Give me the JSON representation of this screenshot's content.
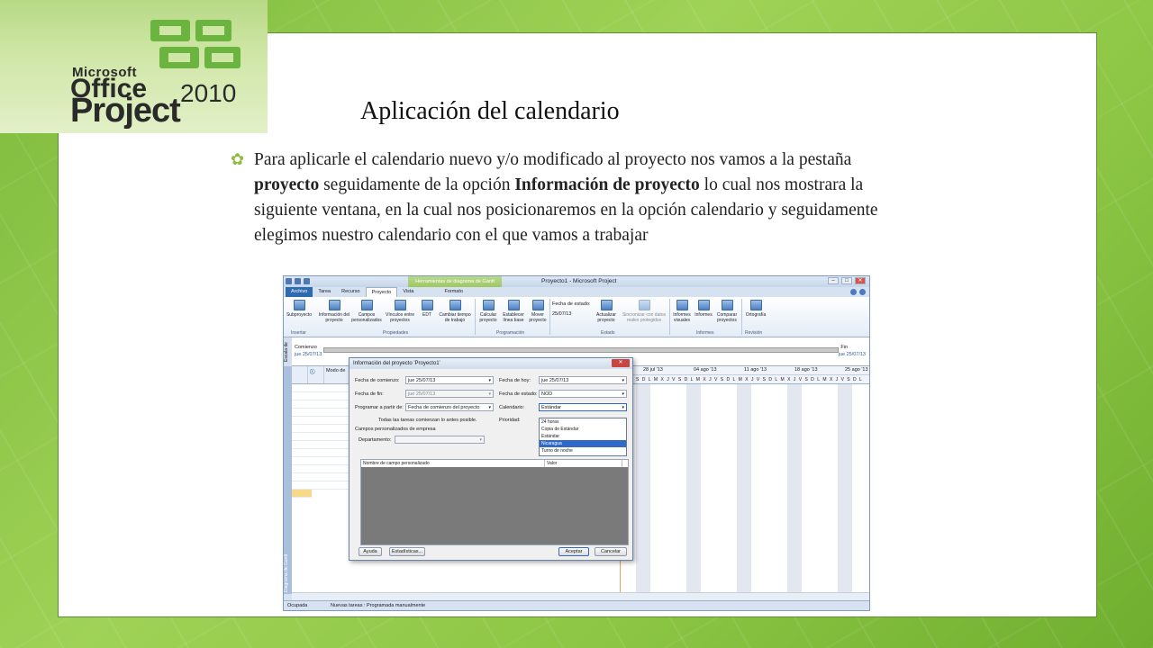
{
  "logo": {
    "microsoft": "Microsoft",
    "office": "Office",
    "year": "2010",
    "project": "Project",
    "mark_color": "#6ab43f"
  },
  "slide": {
    "title": "Aplicación del calendario",
    "bullet_parts": [
      "Para aplicarle el calendario nuevo y/o modificado al proyecto nos vamos a la pestaña ",
      "proyecto",
      " seguidamente de la opción ",
      "Información de proyecto",
      " lo cual nos mostrara la siguiente ventana, en la cual nos posicionaremos en la opción calendario y seguidamente elegimos nuestro calendario con el que vamos a trabajar"
    ]
  },
  "app": {
    "context_tab": "Herramientas de diagrama de Gantt",
    "window_title": "Proyecto1 - Microsoft Project",
    "tabs": [
      "Archivo",
      "Tarea",
      "Recurso",
      "Proyecto",
      "Vista",
      "Formato"
    ],
    "ribbon": {
      "buttons": [
        {
          "label": "Subproyecto"
        },
        {
          "label": "Información del proyecto"
        },
        {
          "label": "Campos personalizados"
        },
        {
          "label": "Vínculos entre proyectos"
        },
        {
          "label": "EDT"
        },
        {
          "label": "Cambiar tiempo de trabajo"
        },
        {
          "label": "Calcular proyecto"
        },
        {
          "label": "Establecer línea base"
        },
        {
          "label": "Mover proyecto"
        },
        {
          "label": "Actualizar proyecto"
        },
        {
          "label": "Sincronizar con datos reales protegidos"
        },
        {
          "label": "Informes visuales"
        },
        {
          "label": "Informes"
        },
        {
          "label": "Comparar proyectos"
        },
        {
          "label": "Ortografía"
        }
      ],
      "groups": [
        "Insertar",
        "Propiedades",
        "Programación",
        "Estado",
        "Informes",
        "Revisión"
      ],
      "fecha_estado_label": "Fecha de estado:",
      "fecha_estado_value": "25/07/13"
    },
    "timeline": {
      "side_label": "Escala de",
      "start_label": "Comienzo",
      "start_date": "jue 25/07/13",
      "end_label": "Fin",
      "end_date": "jue 25/07/13"
    },
    "grid": {
      "headers": [
        "",
        "ⓘ",
        "Modo de",
        "",
        "",
        ""
      ]
    },
    "side_view_label": "Diagrama de Gantt",
    "chart": {
      "weeks": [
        "28 jul '13",
        "04 ago '13",
        "11 ago '13",
        "18 ago '13",
        "25 ago '13"
      ],
      "days": "SDLMXJVSDLMXJVSDLMXJVSDLMXJVSDLMXJVSDL"
    },
    "status": {
      "mode": "Ocupada",
      "new_tasks": "Nuevas tareas : Programada manualmente"
    }
  },
  "dialog": {
    "title": "Información del proyecto 'Proyecto1'",
    "close": "✕",
    "fecha_comienzo_label": "Fecha de comienzo:",
    "fecha_comienzo_value": "jue 25/07/13",
    "fecha_hoy_label": "Fecha de hoy:",
    "fecha_hoy_value": "jue 25/07/13",
    "fecha_fin_label": "Fecha de fin:",
    "fecha_fin_value": "jue 25/07/13",
    "fecha_estado_label": "Fecha de estado:",
    "fecha_estado_value": "NOD",
    "programar_label": "Programar a partir de:",
    "programar_value": "Fecha de comienzo del proyecto",
    "calendario_label": "Calendario:",
    "calendario_value": "Estándar",
    "note": "Todas las tareas comienzan lo antes posible.",
    "prioridad_label": "Prioridad:",
    "campos_label": "Campos personalizados de empresa",
    "departamento_label": "Departamento:",
    "calendar_options": [
      "24 horas",
      "Copia de Estándar",
      "Estándar",
      "Nicaragua",
      "Turno de noche"
    ],
    "selected_option_index": 3,
    "table_headers": [
      "Nombre de campo personalizado",
      "Valor"
    ],
    "buttons": {
      "ayuda": "Ayuda",
      "estadisticas": "Estadísticas...",
      "aceptar": "Aceptar",
      "cancelar": "Cancelar"
    }
  }
}
